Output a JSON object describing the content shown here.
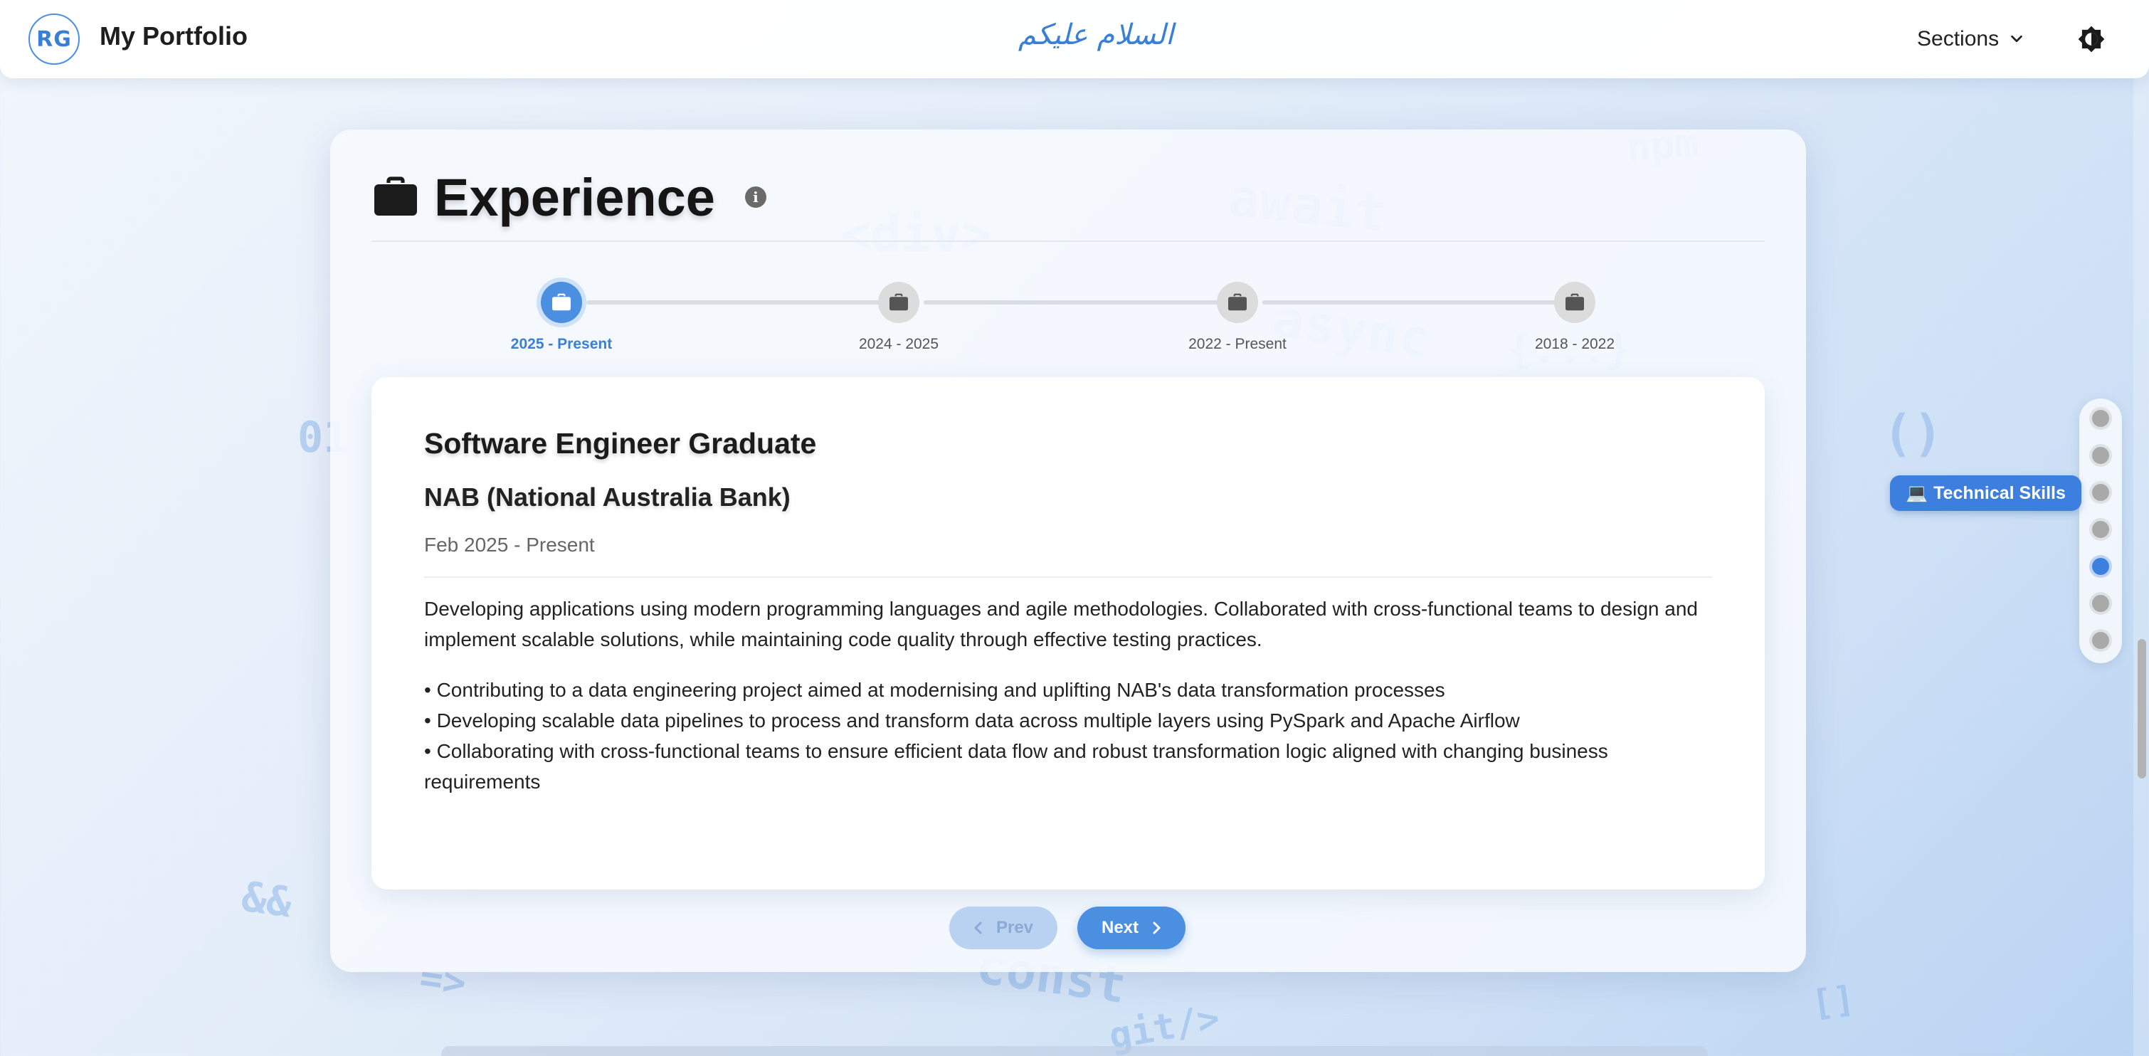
{
  "header": {
    "logo_text": "RG",
    "title": "My Portfolio",
    "greeting": "السلام عليكم",
    "sections_label": "Sections",
    "sections_icon": "chevron-down-icon",
    "theme_icon": "brightness-icon"
  },
  "background_words": [
    "npm",
    "await",
    "<div>",
    "async",
    "{...}",
    "01",
    "()",
    "&&",
    "=>",
    "const",
    "git/>",
    "[]"
  ],
  "experience": {
    "title": "Experience",
    "title_icon": "briefcase-icon",
    "info_icon": "info-icon",
    "timeline": [
      {
        "label": "2025 - Present",
        "active": true
      },
      {
        "label": "2024 - 2025",
        "active": false
      },
      {
        "label": "2022 - Present",
        "active": false
      },
      {
        "label": "2018 - 2022",
        "active": false
      }
    ],
    "current": {
      "role": "Software Engineer Graduate",
      "company": "NAB (National Australia Bank)",
      "dates": "Feb 2025 - Present",
      "description": "Developing applications using modern programming languages and agile methodologies. Collaborated with cross-functional teams to design and implement scalable solutions, while maintaining code quality through effective testing practices.",
      "bullets": [
        "• Contributing to a data engineering project aimed at modernising and uplifting NAB's data transformation processes",
        "• Developing scalable data pipelines to process and transform data across multiple layers using PySpark and Apache Airflow",
        "• Collaborating with cross-functional teams to ensure efficient data flow and robust transformation logic aligned with changing business requirements"
      ]
    },
    "pager": {
      "prev_label": "Prev",
      "next_label": "Next"
    }
  },
  "side_nav": {
    "tooltip_icon": "💻",
    "tooltip_label": "Technical Skills",
    "dot_count": 7,
    "active_index": 4
  },
  "colors": {
    "accent": "#4a8fe0",
    "inactive_node": "#dcdcdc",
    "text": "#1b1b1b"
  }
}
